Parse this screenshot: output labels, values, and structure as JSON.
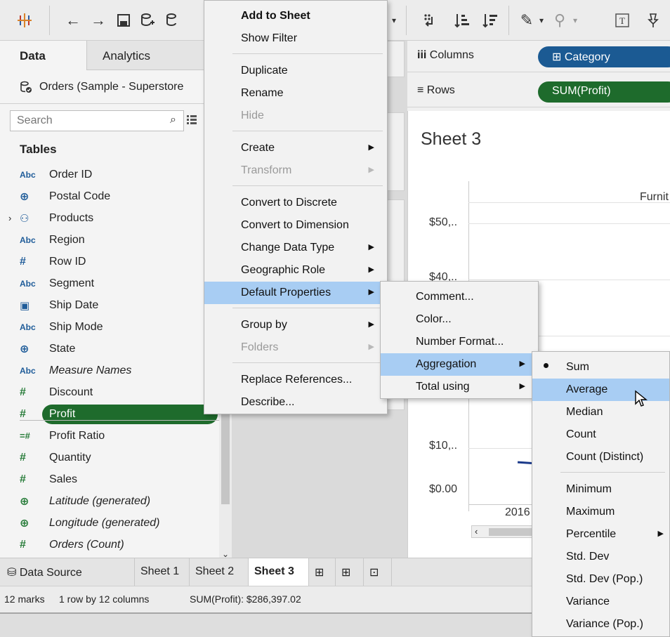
{
  "toolbar": {
    "icons": [
      "tableau-logo-icon",
      "back-arrow-icon",
      "forward-arrow-icon",
      "save-icon",
      "new-datasource-icon",
      "datasource-icon",
      "swap-icon",
      "sort-ascending-icon",
      "sort-descending-icon",
      "highlight-icon",
      "attach-icon",
      "text-label-icon",
      "pin-icon"
    ]
  },
  "left_pane": {
    "tab_data": "Data",
    "tab_analytics": "Analytics",
    "datasource_name": "Orders (Sample - Superstore",
    "search_placeholder": "Search",
    "tables_title": "Tables",
    "fields": [
      {
        "type": "Abc",
        "label": "Order ID"
      },
      {
        "type": "globe",
        "label": "Postal Code"
      },
      {
        "type": "hierarchy",
        "label": "Products"
      },
      {
        "type": "Abc",
        "label": "Region"
      },
      {
        "type": "#",
        "label": "Row ID"
      },
      {
        "type": "Abc",
        "label": "Segment"
      },
      {
        "type": "calendar",
        "label": "Ship Date"
      },
      {
        "type": "Abc",
        "label": "Ship Mode"
      },
      {
        "type": "globe",
        "label": "State"
      },
      {
        "type": "Abc",
        "label": "Measure Names"
      },
      {
        "type": "#",
        "label": "Discount"
      },
      {
        "type": "#",
        "label": "Profit"
      },
      {
        "type": "=#",
        "label": "Profit Ratio"
      },
      {
        "type": "#",
        "label": "Quantity"
      },
      {
        "type": "#",
        "label": "Sales"
      },
      {
        "type": "globe",
        "label": "Latitude (generated)"
      },
      {
        "type": "globe",
        "label": "Longitude (generated)"
      },
      {
        "type": "#",
        "label": "Orders (Count)"
      }
    ]
  },
  "shelves": {
    "columns_label": "Columns",
    "columns_pill": "Category",
    "rows_label": "Rows",
    "rows_pill": "SUM(Profit)"
  },
  "view": {
    "sheet_title": "Sheet 3",
    "column_header": "Furnit",
    "y_ticks": [
      "$50,..",
      "$40,..",
      "$10,..",
      "$0.00"
    ],
    "x_tick": "2016"
  },
  "tabs": {
    "data_source": "Data Source",
    "sheets": [
      "Sheet 1",
      "Sheet 2",
      "Sheet 3"
    ]
  },
  "status": {
    "marks": "12 marks",
    "dims": "1 row by 12 columns",
    "sum": "SUM(Profit): $286,397.02"
  },
  "menu_main": {
    "items": [
      "Add to Sheet",
      "Show Filter",
      "Duplicate",
      "Rename",
      "Hide",
      "Create",
      "Transform",
      "Convert to Discrete",
      "Convert to Dimension",
      "Change Data Type",
      "Geographic Role",
      "Default Properties",
      "Group by",
      "Folders",
      "Replace References...",
      "Describe..."
    ]
  },
  "menu_default": {
    "items": [
      "Comment...",
      "Color...",
      "Number Format...",
      "Aggregation",
      "Total using"
    ]
  },
  "menu_agg": {
    "items": [
      "Sum",
      "Average",
      "Median",
      "Count",
      "Count (Distinct)",
      "Minimum",
      "Maximum",
      "Percentile",
      "Std. Dev",
      "Std. Dev (Pop.)",
      "Variance",
      "Variance (Pop.)"
    ],
    "selected": "Sum",
    "hover": "Average"
  },
  "colors": {
    "menu_highlight": "#a8cdf3",
    "dimension_pill": "#1b5a93",
    "measure_pill": "#1e6b2c"
  }
}
